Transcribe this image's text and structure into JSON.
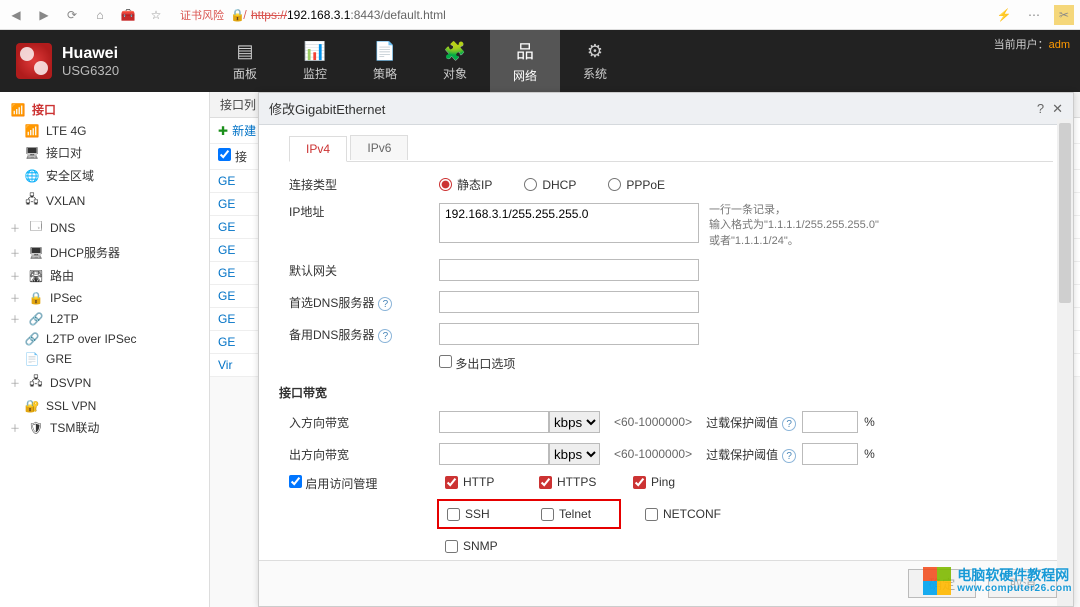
{
  "browser": {
    "cert_warning": "证书风险",
    "url_scheme": "https://",
    "url_host": "192.168.3.1",
    "url_port_path": ":8443/default.html"
  },
  "brand": {
    "name": "Huawei",
    "model": "USG6320"
  },
  "user_label": "当前用户：",
  "user_name": "adm",
  "top_nav": {
    "dashboard": "面板",
    "monitor": "监控",
    "policy": "策略",
    "object": "对象",
    "network": "网络",
    "system": "系统"
  },
  "left_tree": {
    "interface": "接口",
    "lte4g": "LTE 4G",
    "ifpair": "接口对",
    "zone": "安全区域",
    "vxlan": "VXLAN",
    "dns": "DNS",
    "dhcp": "DHCP服务器",
    "route": "路由",
    "ipsec": "IPSec",
    "l2tp": "L2TP",
    "l2tpipsec": "L2TP over IPSec",
    "gre": "GRE",
    "dsvpn": "DSVPN",
    "sslvpn": "SSL VPN",
    "tsm": "TSM联动"
  },
  "list": {
    "title": "接口列",
    "add": "新建",
    "select_label": "接",
    "rows": [
      "GE",
      "GE",
      "GE",
      "GE",
      "GE",
      "GE",
      "GE",
      "GE",
      "Vir"
    ]
  },
  "modal": {
    "title": "修改GigabitEthernet",
    "tab_ipv4": "IPv4",
    "tab_ipv6": "IPv6",
    "conn_type": "连接类型",
    "static_ip": "静态IP",
    "dhcp": "DHCP",
    "pppoe": "PPPoE",
    "ip_addr": "IP地址",
    "ip_value": "192.168.3.1/255.255.255.0",
    "ip_hint1": "一行一条记录，",
    "ip_hint2": "输入格式为\"1.1.1.1/255.255.255.0\"",
    "ip_hint3": "或者\"1.1.1.1/24\"。",
    "gateway": "默认网关",
    "dns1": "首选DNS服务器",
    "dns2": "备用DNS服务器",
    "multiexit": "多出口选项",
    "bw_title": "接口带宽",
    "in_bw": "入方向带宽",
    "out_bw": "出方向带宽",
    "unit": "kbps",
    "range": "<60-1000000>",
    "overload": "过载保护阈值",
    "pct": "%",
    "enable_access": "启用访问管理",
    "http": "HTTP",
    "https": "HTTPS",
    "ping": "Ping",
    "ssh": "SSH",
    "telnet": "Telnet",
    "netconf": "NETCONF",
    "snmp": "SNMP",
    "ok": "确定",
    "cancel": "取消"
  },
  "watermark": {
    "line1": "电脑软硬件教程网",
    "line2": "www.computer26.com"
  }
}
